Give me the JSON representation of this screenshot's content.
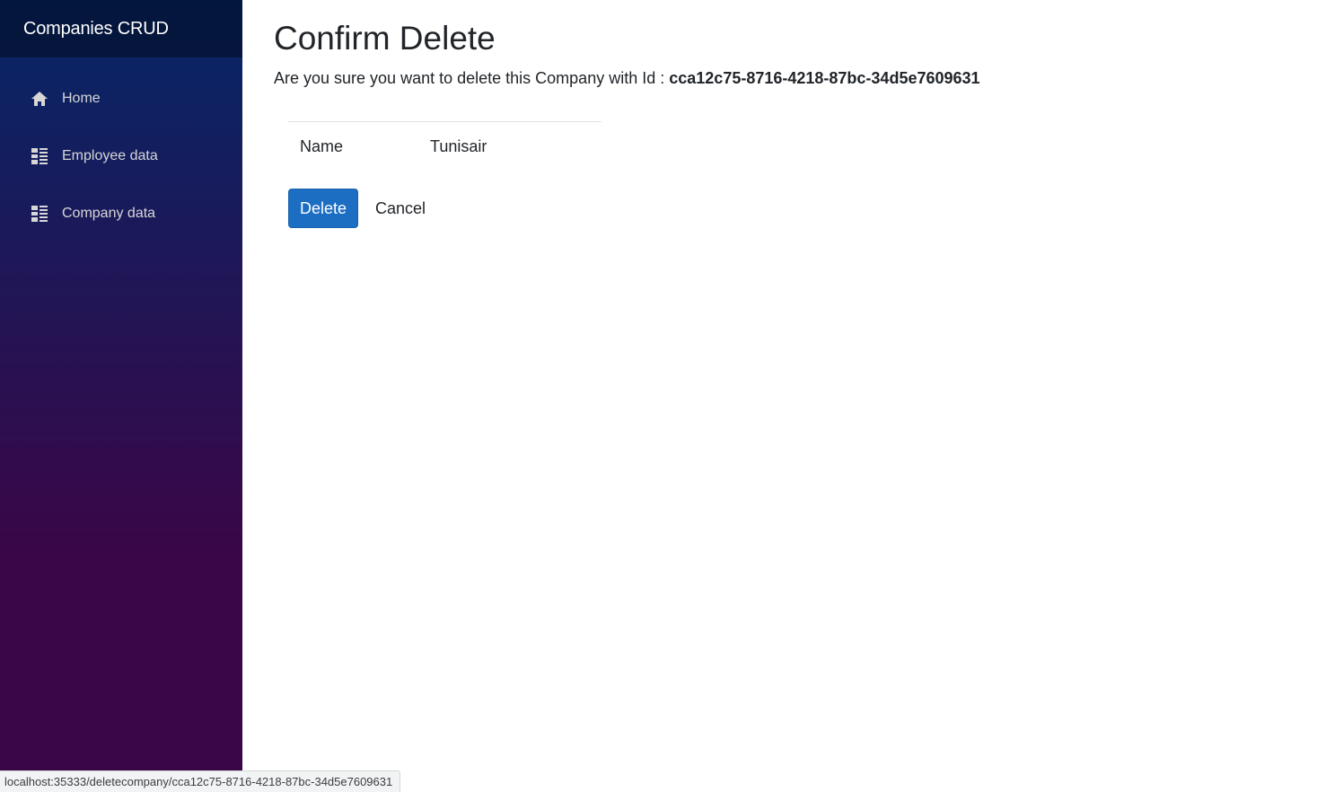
{
  "sidebar": {
    "brand": "Companies CRUD",
    "items": [
      {
        "label": "Home",
        "icon": "home-icon"
      },
      {
        "label": "Employee data",
        "icon": "list-icon"
      },
      {
        "label": "Company data",
        "icon": "list-icon"
      }
    ]
  },
  "main": {
    "title": "Confirm Delete",
    "prompt": "Are you sure you want to delete this Company with Id :",
    "company_id": "cca12c75-8716-4218-87bc-34d5e7609631",
    "details": [
      {
        "label": "Name",
        "value": "Tunisair"
      }
    ],
    "delete_label": "Delete",
    "cancel_label": "Cancel"
  },
  "status_bar": {
    "url": "localhost:35333/deletecompany/cca12c75-8716-4218-87bc-34d5e7609631"
  },
  "colors": {
    "primary_button": "#1b6ec2",
    "sidebar_top": "#052767",
    "sidebar_bottom": "#3a0647"
  }
}
